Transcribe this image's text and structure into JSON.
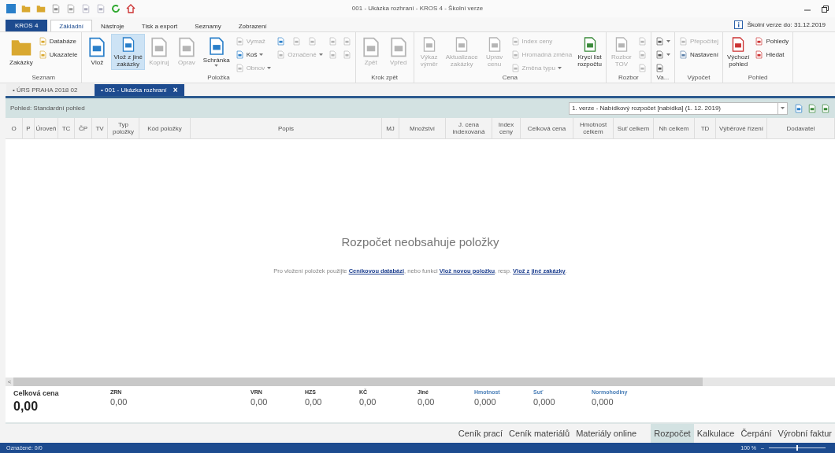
{
  "window": {
    "title": "001 - Ukázka rozhraní - KROS 4 - Školní verze"
  },
  "ribbon": {
    "app_button": "KROS 4",
    "tabs": [
      {
        "label": "Základní",
        "selected": true
      },
      {
        "label": "Nástroje",
        "selected": false
      },
      {
        "label": "Tisk a export",
        "selected": false
      },
      {
        "label": "Seznamy",
        "selected": false
      },
      {
        "label": "Zobrazení",
        "selected": false
      }
    ],
    "license_note": "Školní verze do: 31.12.2019",
    "groups": [
      {
        "label": "Seznam",
        "columns": [
          {
            "rows": [
              [
                {
                  "kind": "large",
                  "label": "Zakázky",
                  "disabled": false,
                  "selected": false,
                  "dropdown": false
                }
              ]
            ]
          },
          {
            "rows": [
              [
                {
                  "kind": "small",
                  "label": "Databáze",
                  "disabled": false,
                  "selected": false,
                  "dropdown": false
                }
              ],
              [
                {
                  "kind": "small",
                  "label": "Ukazatele",
                  "disabled": false,
                  "selected": false,
                  "dropdown": false
                }
              ]
            ]
          }
        ]
      },
      {
        "label": "Položka",
        "columns": [
          {
            "rows": [
              [
                {
                  "kind": "large",
                  "label": "Vlož",
                  "disabled": false,
                  "selected": false,
                  "dropdown": false
                }
              ]
            ]
          },
          {
            "rows": [
              [
                {
                  "kind": "large",
                  "label": "Vlož z jiné\nzakázky",
                  "disabled": false,
                  "selected": true,
                  "dropdown": false
                }
              ]
            ]
          },
          {
            "rows": [
              [
                {
                  "kind": "large",
                  "label": "Kopíruj",
                  "disabled": true,
                  "selected": false,
                  "dropdown": false
                }
              ]
            ]
          },
          {
            "rows": [
              [
                {
                  "kind": "large",
                  "label": "Oprav",
                  "disabled": true,
                  "selected": false,
                  "dropdown": false
                }
              ]
            ]
          },
          {
            "rows": [
              [
                {
                  "kind": "large",
                  "label": "Schránka",
                  "disabled": false,
                  "selected": false,
                  "dropdown": true
                }
              ]
            ]
          },
          {
            "rows": [
              [
                {
                  "kind": "small",
                  "label": "Vymaž",
                  "disabled": true,
                  "selected": false,
                  "dropdown": false
                }
              ],
              [
                {
                  "kind": "small",
                  "label": "Koš",
                  "disabled": false,
                  "selected": false,
                  "dropdown": true
                }
              ],
              [
                {
                  "kind": "small",
                  "label": "Obnov",
                  "disabled": true,
                  "selected": false,
                  "dropdown": true
                }
              ]
            ]
          },
          {
            "rows": [
              [
                {
                  "kind": "icon",
                  "disabled": false,
                  "selected": false,
                  "dropdown": false
                },
                {
                  "kind": "icon",
                  "disabled": true,
                  "selected": false,
                  "dropdown": false
                },
                {
                  "kind": "icon",
                  "disabled": true,
                  "selected": false,
                  "dropdown": false
                }
              ],
              [
                {
                  "kind": "small",
                  "label": "Označené",
                  "disabled": true,
                  "selected": false,
                  "dropdown": true
                }
              ]
            ]
          },
          {
            "rows": [
              [
                {
                  "kind": "icon",
                  "disabled": true,
                  "selected": false,
                  "dropdown": false
                }
              ],
              [
                {
                  "kind": "icon",
                  "disabled": true,
                  "selected": false,
                  "dropdown": false
                }
              ]
            ]
          },
          {
            "rows": [
              [
                {
                  "kind": "icon",
                  "disabled": true,
                  "selected": false,
                  "dropdown": false
                }
              ],
              [
                {
                  "kind": "icon",
                  "disabled": true,
                  "selected": false,
                  "dropdown": false
                }
              ]
            ]
          }
        ]
      },
      {
        "label": "Krok zpět",
        "columns": [
          {
            "rows": [
              [
                {
                  "kind": "large",
                  "label": "Zpět",
                  "disabled": true,
                  "selected": false,
                  "dropdown": false
                }
              ]
            ]
          },
          {
            "rows": [
              [
                {
                  "kind": "large",
                  "label": "Vpřed",
                  "disabled": true,
                  "selected": false,
                  "dropdown": false
                }
              ]
            ]
          }
        ]
      },
      {
        "label": "Cena",
        "columns": [
          {
            "rows": [
              [
                {
                  "kind": "large",
                  "label": "Výkaz\nvýměr",
                  "disabled": true,
                  "selected": false,
                  "dropdown": false
                }
              ]
            ]
          },
          {
            "rows": [
              [
                {
                  "kind": "large",
                  "label": "Aktualizace\nzakázky",
                  "disabled": true,
                  "selected": false,
                  "dropdown": false
                }
              ]
            ]
          },
          {
            "rows": [
              [
                {
                  "kind": "large",
                  "label": "Uprav\ncenu",
                  "disabled": true,
                  "selected": false,
                  "dropdown": false
                }
              ]
            ]
          },
          {
            "rows": [
              [
                {
                  "kind": "small",
                  "label": "Index ceny",
                  "disabled": true,
                  "selected": false,
                  "dropdown": false
                }
              ],
              [
                {
                  "kind": "small",
                  "label": "Hromadná změna",
                  "disabled": true,
                  "selected": false,
                  "dropdown": false
                }
              ],
              [
                {
                  "kind": "small",
                  "label": "Změna typu",
                  "disabled": true,
                  "selected": false,
                  "dropdown": true
                }
              ]
            ]
          },
          {
            "rows": [
              [
                {
                  "kind": "large",
                  "label": "Krycí list\nrozpočtu",
                  "disabled": false,
                  "selected": false,
                  "dropdown": false
                }
              ]
            ]
          }
        ]
      },
      {
        "label": "Rozbor",
        "columns": [
          {
            "rows": [
              [
                {
                  "kind": "large",
                  "label": "Rozbor\nTOV",
                  "disabled": true,
                  "selected": false,
                  "dropdown": false
                }
              ]
            ]
          },
          {
            "rows": [
              [
                {
                  "kind": "icon",
                  "disabled": true,
                  "selected": false,
                  "dropdown": false
                }
              ],
              [
                {
                  "kind": "icon",
                  "disabled": true,
                  "selected": false,
                  "dropdown": false
                }
              ],
              [
                {
                  "kind": "icon",
                  "disabled": true,
                  "selected": false,
                  "dropdown": false
                }
              ]
            ]
          }
        ]
      },
      {
        "label": "Va...",
        "columns": [
          {
            "rows": [
              [
                {
                  "kind": "icon",
                  "disabled": false,
                  "selected": false,
                  "dropdown": true
                }
              ],
              [
                {
                  "kind": "icon",
                  "disabled": false,
                  "selected": false,
                  "dropdown": true
                }
              ],
              [
                {
                  "kind": "icon",
                  "disabled": false,
                  "selected": false,
                  "dropdown": false
                }
              ]
            ]
          }
        ]
      },
      {
        "label": "Výpočet",
        "columns": [
          {
            "rows": [
              [
                {
                  "kind": "small",
                  "label": "Přepočítej",
                  "disabled": true,
                  "selected": false,
                  "dropdown": false
                }
              ],
              [
                {
                  "kind": "small",
                  "label": "Nastavení",
                  "disabled": false,
                  "selected": false,
                  "dropdown": false
                }
              ]
            ]
          }
        ]
      },
      {
        "label": "Pohled",
        "columns": [
          {
            "rows": [
              [
                {
                  "kind": "large",
                  "label": "Výchozí\npohled",
                  "disabled": false,
                  "selected": false,
                  "dropdown": false
                }
              ]
            ]
          },
          {
            "rows": [
              [
                {
                  "kind": "small",
                  "label": "Pohledy",
                  "disabled": false,
                  "selected": false,
                  "dropdown": false
                }
              ],
              [
                {
                  "kind": "small",
                  "label": "Hledat",
                  "disabled": false,
                  "selected": false,
                  "dropdown": false
                }
              ]
            ]
          }
        ]
      }
    ]
  },
  "document_tabs": [
    {
      "label": "• ÚRS PRAHA 2018 02",
      "selected": false
    },
    {
      "label": "• 001 - Ukázka rozhraní",
      "selected": true,
      "close": "×"
    }
  ],
  "view_bar": {
    "label": "Pohled: Standardní pohled",
    "version": "1. verze - Nabídkový rozpočet [nabídka] (1. 12. 2019)"
  },
  "table": {
    "columns": [
      "O",
      "P",
      "Úroveň",
      "TC",
      "ČP",
      "TV",
      "Typ\npoložky",
      "Kód položky",
      "Popis",
      "MJ",
      "Množství",
      "J. cena\nindexovaná",
      "Index\nceny",
      "Celková cena",
      "Hmotnost\ncelkem",
      "Suť celkem",
      "Nh celkem",
      "TD",
      "Výběrové řízení",
      "Dodavatel"
    ],
    "empty_title": "Rozpočet neobsahuje položky",
    "empty_hint": [
      {
        "kind": "text",
        "text": "Pro vložení položek použijte "
      },
      {
        "kind": "link",
        "text": "Ceníkovou databázi"
      },
      {
        "kind": "text",
        "text": ", nebo funkci "
      },
      {
        "kind": "link",
        "text": "Vlož novou položku"
      },
      {
        "kind": "text",
        "text": ", resp. "
      },
      {
        "kind": "link",
        "text": "Vlož z jiné zakázky"
      },
      {
        "kind": "text",
        "text": "."
      }
    ],
    "scroll_left": "<"
  },
  "totals": [
    {
      "kind": "total",
      "label": "Celková cena",
      "value": "0,00"
    },
    {
      "kind": "price",
      "label": "ZRN",
      "value": "0,00"
    },
    {
      "kind": "price",
      "label": "VRN",
      "value": "0,00"
    },
    {
      "kind": "price",
      "label": "HZS",
      "value": "0,00"
    },
    {
      "kind": "price",
      "label": "KČ",
      "value": "0,00"
    },
    {
      "kind": "price",
      "label": "Jiné",
      "value": "0,00"
    },
    {
      "kind": "quantity",
      "label": "Hmotnost",
      "value": "0,000"
    },
    {
      "kind": "quantity",
      "label": "Suť",
      "value": "0,000"
    },
    {
      "kind": "quantity",
      "label": "Normohodiny",
      "value": "0,000"
    }
  ],
  "module_groups": [
    {
      "items": [
        {
          "label": "Ceník prací",
          "selected": false
        },
        {
          "label": "Ceník materiálů",
          "selected": false
        },
        {
          "label": "Materiály online",
          "selected": false
        }
      ]
    },
    {
      "items": [
        {
          "label": "Rozpočet",
          "selected": true
        },
        {
          "label": "Kalkulace",
          "selected": false
        },
        {
          "label": "Čerpání",
          "selected": false
        },
        {
          "label": "Výrobní faktur",
          "selected": false
        }
      ]
    }
  ],
  "status_bar": {
    "marked": "Označené: 0/0",
    "zoom": "100 %",
    "zoom_out": "–",
    "level": 0.48
  }
}
